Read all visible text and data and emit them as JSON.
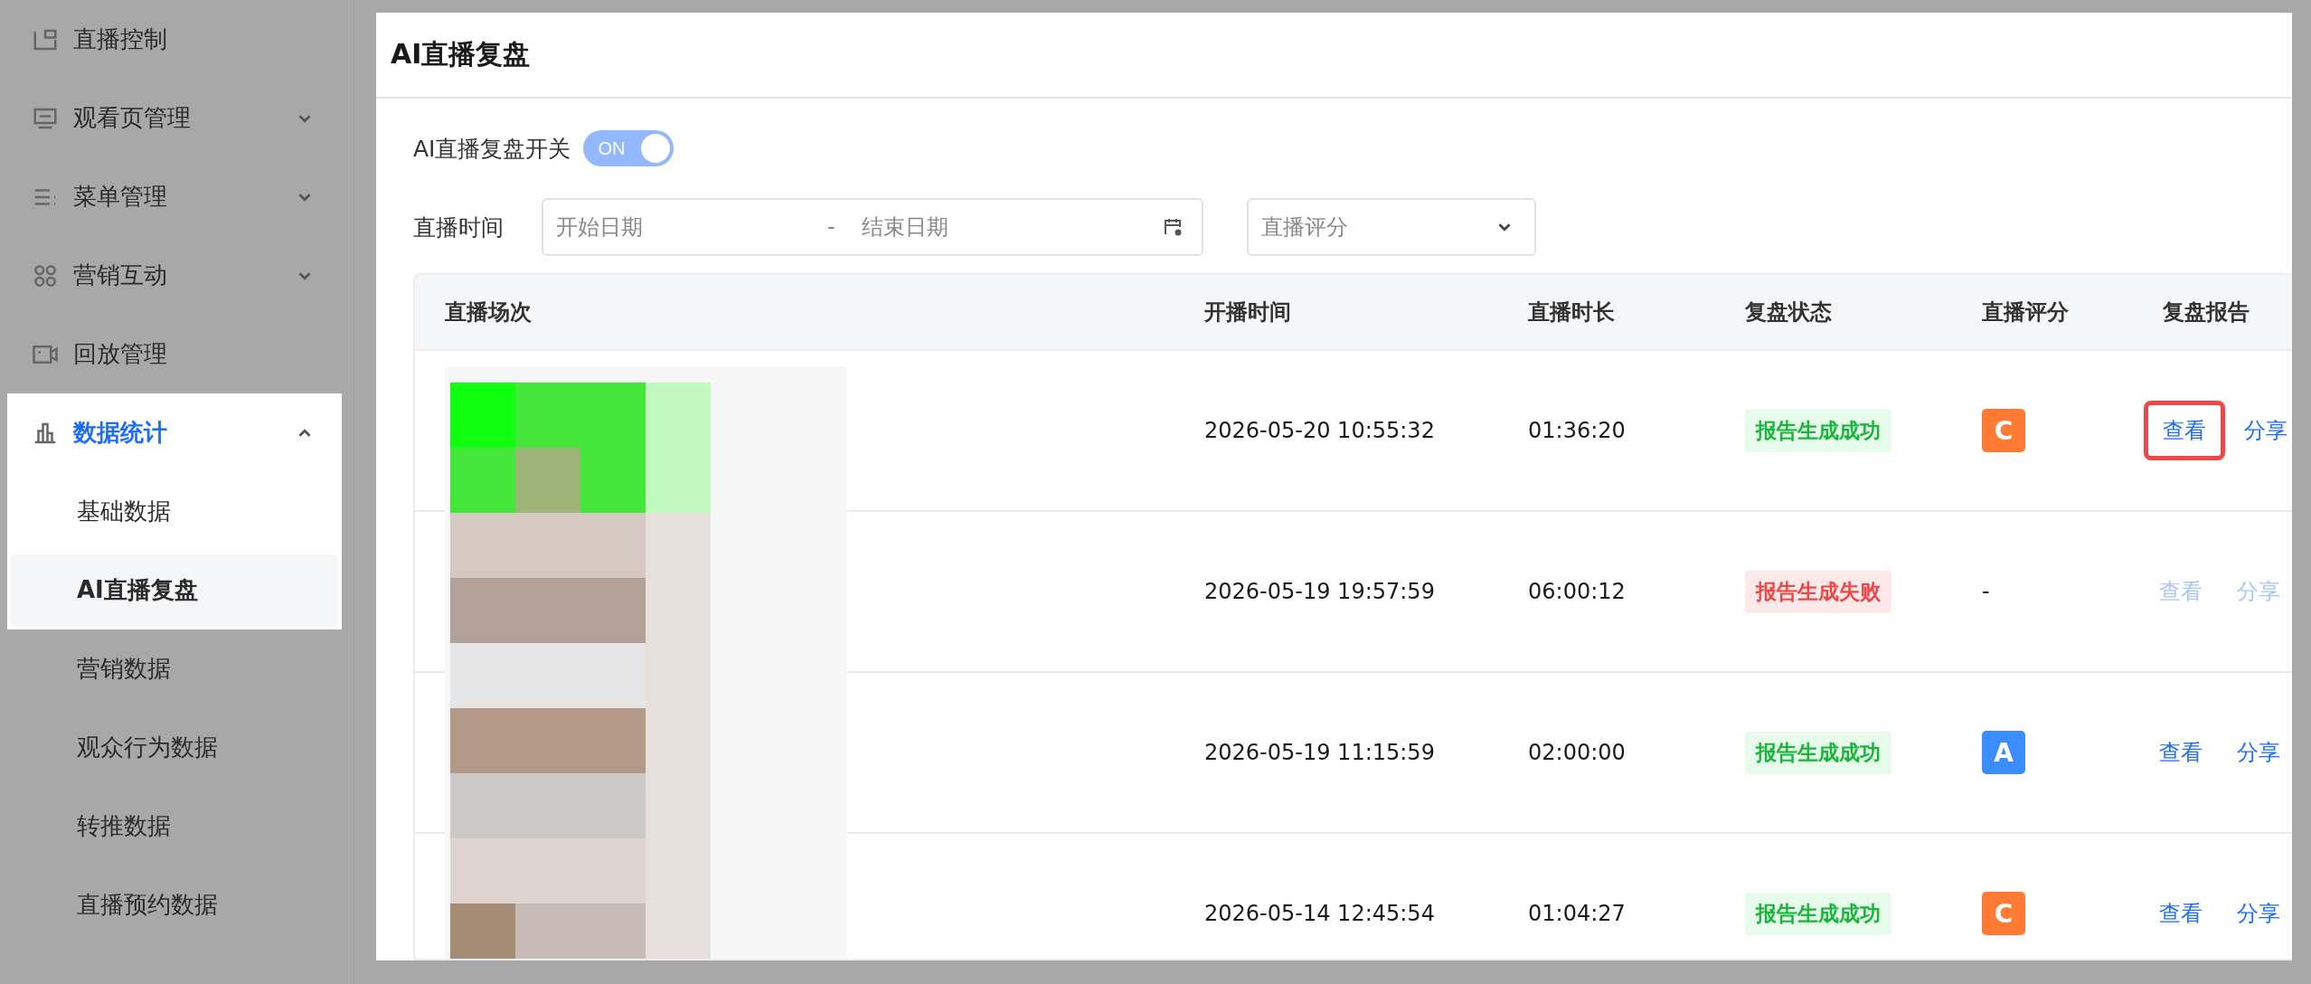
{
  "sidebar": {
    "items": [
      {
        "label": "直播控制",
        "selected": false,
        "spotlit": false
      },
      {
        "label": "观看页管理",
        "selected": false,
        "expanded": false,
        "spotlit": false
      },
      {
        "label": "菜单管理",
        "selected": false,
        "expanded": false,
        "spotlit": false
      },
      {
        "label": "营销互动",
        "selected": false,
        "expanded": false,
        "spotlit": false
      },
      {
        "label": "回放管理",
        "selected": false,
        "spotlit": false
      },
      {
        "label": "数据统计",
        "selected": true,
        "expanded": true,
        "spotlit": true,
        "children": [
          {
            "label": "基础数据",
            "selected": false,
            "spotlit": true
          },
          {
            "label": "AI直播复盘",
            "selected": true,
            "spotlit": true
          },
          {
            "label": "营销数据",
            "selected": false,
            "spotlit": false
          },
          {
            "label": "观众行为数据",
            "selected": false,
            "spotlit": false
          },
          {
            "label": "转推数据",
            "selected": false,
            "spotlit": false
          },
          {
            "label": "直播预约数据",
            "selected": false,
            "spotlit": false
          }
        ]
      }
    ]
  },
  "panel": {
    "title": "AI直播复盘",
    "switch": {
      "label": "AI直播复盘开关",
      "on": true,
      "text": "ON"
    },
    "filters": {
      "date_label": "直播时间",
      "start_placeholder": "开始日期",
      "separator": "-",
      "end_placeholder": "结束日期",
      "score_placeholder": "直播评分"
    },
    "table": {
      "columns": [
        "直播场次",
        "开播时间",
        "直播时长",
        "复盘状态",
        "直播评分",
        "复盘报告"
      ],
      "rows": [
        {
          "start_time": "2026-05-20 10:55:32",
          "duration": "01:36:20",
          "status": {
            "kind": "success",
            "text": "报告生成成功"
          },
          "score": {
            "kind": "grade",
            "grade": "C",
            "color": "#ff7a33"
          },
          "actions": [
            {
              "label": "查看",
              "disabled": false,
              "focused": true
            },
            {
              "label": "分享",
              "disabled": false,
              "focused": false
            }
          ]
        },
        {
          "start_time": "2026-05-19 19:57:59",
          "duration": "06:00:12",
          "status": {
            "kind": "failed",
            "text": "报告生成失败"
          },
          "score": {
            "kind": "none",
            "text": "-"
          },
          "actions": [
            {
              "label": "查看",
              "disabled": true,
              "focused": false
            },
            {
              "label": "分享",
              "disabled": true,
              "focused": false
            }
          ]
        },
        {
          "start_time": "2026-05-19 11:15:59",
          "duration": "02:00:00",
          "status": {
            "kind": "success",
            "text": "报告生成成功"
          },
          "score": {
            "kind": "grade",
            "grade": "A",
            "color": "#3a8cff"
          },
          "actions": [
            {
              "label": "查看",
              "disabled": false,
              "focused": false
            },
            {
              "label": "分享",
              "disabled": false,
              "focused": false
            }
          ]
        },
        {
          "start_time": "2026-05-14 12:45:54",
          "duration": "01:04:27",
          "status": {
            "kind": "success",
            "text": "报告生成成功"
          },
          "score": {
            "kind": "grade",
            "grade": "C",
            "color": "#ff7a33"
          },
          "actions": [
            {
              "label": "查看",
              "disabled": false,
              "focused": false
            },
            {
              "label": "分享",
              "disabled": false,
              "focused": false
            }
          ]
        }
      ]
    }
  }
}
